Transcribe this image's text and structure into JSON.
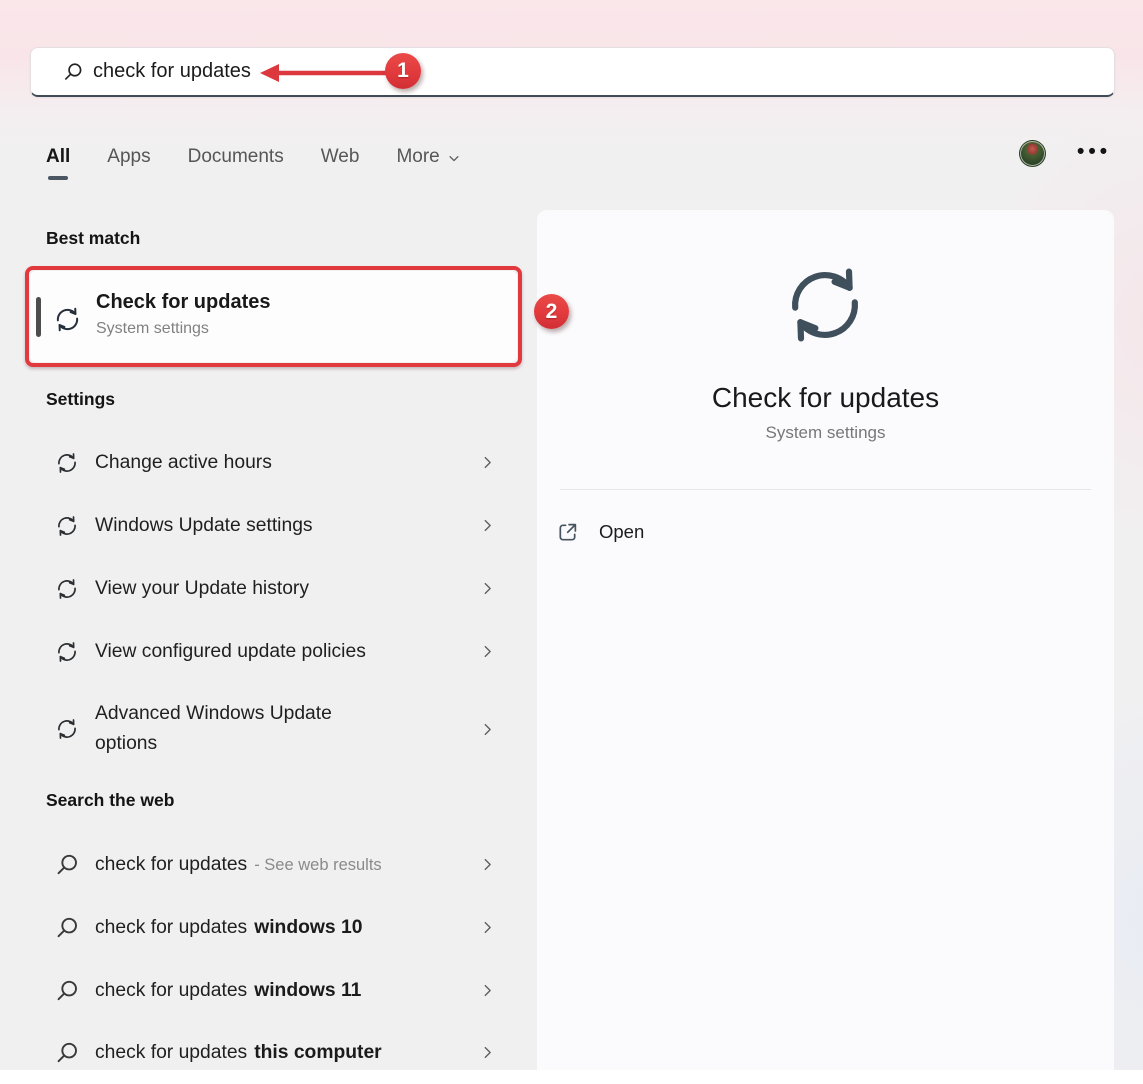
{
  "colors": {
    "accent_red": "#e2393e",
    "tab_underline": "#4a5662",
    "big_icon_slate": "#3f4f5b"
  },
  "annotations": {
    "step1": "1",
    "step2": "2"
  },
  "search": {
    "value": "check for updates"
  },
  "tabs": {
    "items": [
      {
        "label": "All",
        "active": true
      },
      {
        "label": "Apps",
        "active": false
      },
      {
        "label": "Documents",
        "active": false
      },
      {
        "label": "Web",
        "active": false
      },
      {
        "label": "More",
        "active": false
      }
    ]
  },
  "topbar": {
    "more_options": "•••"
  },
  "left": {
    "best_match_heading": "Best match",
    "best_match": {
      "title": "Check for updates",
      "subtitle": "System settings"
    },
    "settings_heading": "Settings",
    "settings_items": [
      {
        "label": "Change active hours"
      },
      {
        "label": "Windows Update settings"
      },
      {
        "label": "View your Update history"
      },
      {
        "label": "View configured update policies"
      },
      {
        "label": "Advanced Windows Update options"
      }
    ],
    "web_heading": "Search the web",
    "web_items": [
      {
        "query": "check for updates",
        "suffix": "- See web results",
        "emphasis": "muted"
      },
      {
        "query": "check for updates",
        "suffix": "windows 10",
        "emphasis": "bold"
      },
      {
        "query": "check for updates",
        "suffix": "windows 11",
        "emphasis": "bold"
      },
      {
        "query": "check for updates",
        "suffix": "this computer",
        "emphasis": "bold"
      }
    ]
  },
  "right": {
    "title": "Check for updates",
    "subtitle": "System settings",
    "open_label": "Open"
  }
}
